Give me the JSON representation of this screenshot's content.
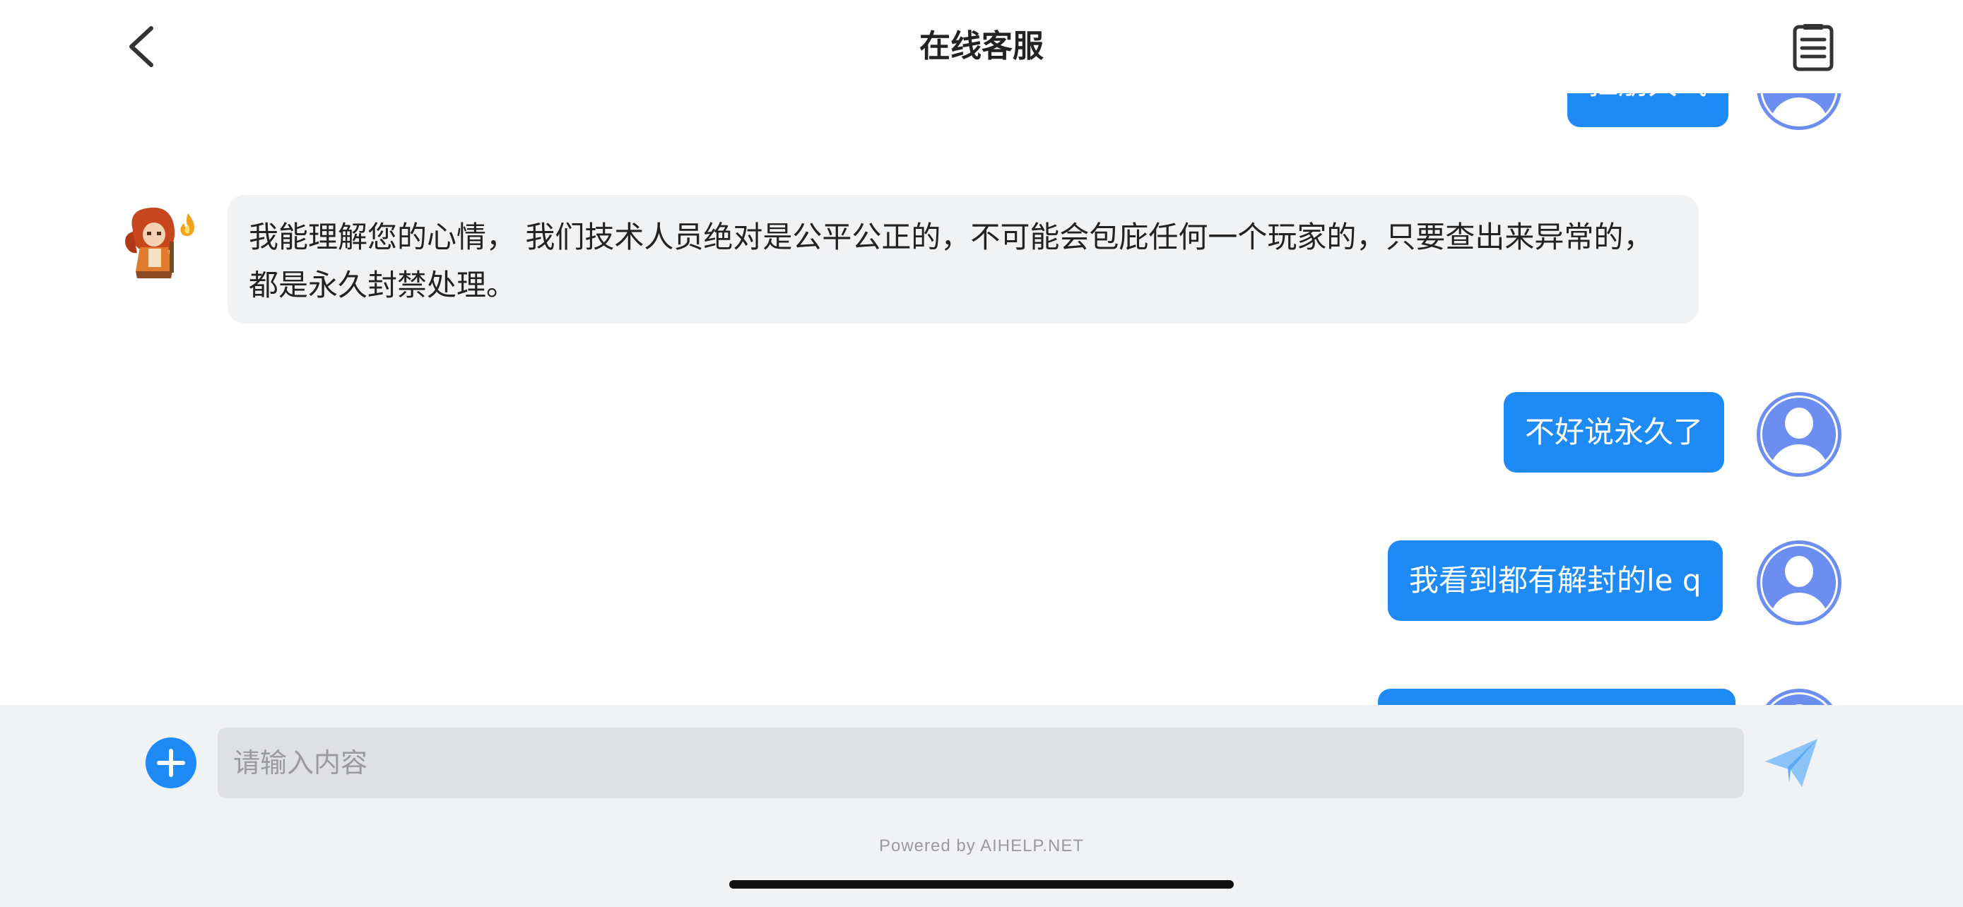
{
  "header": {
    "title": "在线客服"
  },
  "messages": [
    {
      "sender": "user",
      "text": "扛朋大气"
    },
    {
      "sender": "agent",
      "text": "我能理解您的心情， 我们技术人员绝对是公平公正的，不可能会包庇任何一个玩家的，只要查出来异常的，都是永久封禁处理。"
    },
    {
      "sender": "user",
      "text": "不好说永久了"
    },
    {
      "sender": "user",
      "text": "我看到都有解封的le q"
    },
    {
      "sender": "user",
      "text": ""
    }
  ],
  "composer": {
    "placeholder": "请输入内容",
    "value": ""
  },
  "footer": {
    "powered_by": "Powered by AIHELP.NET"
  },
  "colors": {
    "accent": "#1e8af6",
    "agent_bubble": "#f1f2f4",
    "user_avatar": "#6b8ef0",
    "bottom_bar": "#f1f2f4"
  },
  "icons": {
    "back": "chevron-left-icon",
    "history": "document-list-icon",
    "add": "plus-circle-icon",
    "send": "paper-plane-icon"
  }
}
